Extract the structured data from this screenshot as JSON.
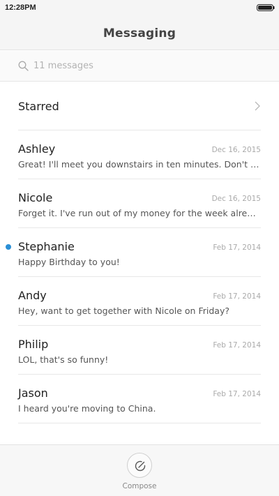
{
  "status_bar": {
    "time": "12:28PM"
  },
  "header": {
    "title": "Messaging"
  },
  "search": {
    "placeholder": "11 messages"
  },
  "starred": {
    "label": "Starred"
  },
  "conversations": [
    {
      "name": "Ashley",
      "date": "Dec 16, 2015",
      "preview": "Great! I'll meet you downstairs in ten minutes. Don't forget",
      "unread": false
    },
    {
      "name": "Nicole",
      "date": "Dec 16, 2015",
      "preview": "Forget it. I've run out of my money for the week already.",
      "unread": false
    },
    {
      "name": "Stephanie",
      "date": "Feb 17, 2014",
      "preview": "Happy Birthday to you!",
      "unread": true
    },
    {
      "name": "Andy",
      "date": "Feb 17, 2014",
      "preview": "Hey, want to get together with Nicole on Friday?",
      "unread": false
    },
    {
      "name": "Philip",
      "date": "Feb 17, 2014",
      "preview": "LOL, that's so funny!",
      "unread": false
    },
    {
      "name": "Jason",
      "date": "Feb 17, 2014",
      "preview": "I heard you're moving to China.",
      "unread": false
    }
  ],
  "bottom_bar": {
    "compose_label": "Compose"
  },
  "colors": {
    "unread_dot": "#2a8fd6",
    "header_bg": "#f5f5f5"
  }
}
